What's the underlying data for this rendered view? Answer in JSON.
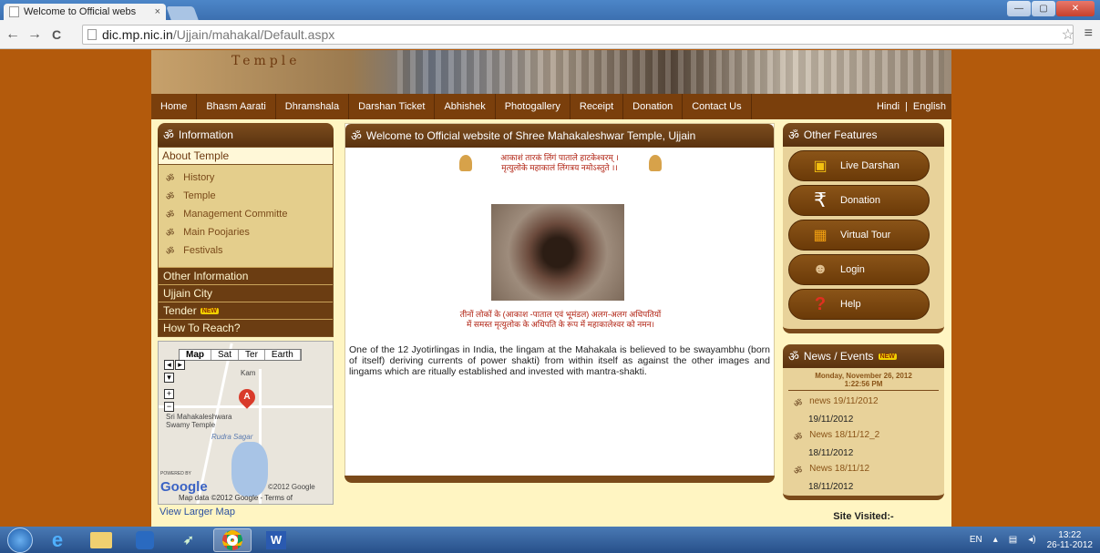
{
  "browser": {
    "tab_title": "Welcome to Official webs",
    "tab_close": "×",
    "url_host": "dic.mp.nic.in",
    "url_path": "/Ujjain/mahakal/Default.aspx",
    "back": "←",
    "forward": "→",
    "reload": "C",
    "bookmark_star": "☆",
    "menu": "≡",
    "minimize": "—",
    "maximize": "▢",
    "close": "✕"
  },
  "banner": {
    "text": "Temple"
  },
  "nav": {
    "items": [
      "Home",
      "Bhasm Aarati",
      "Dhramshala",
      "Darshan Ticket",
      "Abhishek",
      "Photogallery",
      "Receipt",
      "Donation",
      "Contact Us"
    ],
    "hindi": "Hindi",
    "separator": "|",
    "english": "English"
  },
  "left": {
    "header": "Information",
    "om": "ॐ",
    "about_title": "About Temple",
    "sub_items": [
      "History",
      "Temple",
      "Management Committe",
      "Main Poojaries",
      "Festivals"
    ],
    "other_items": [
      "Other Information",
      "Ujjain City",
      "Tender",
      "How To Reach?"
    ],
    "new_badge": "NEW",
    "map": {
      "types": [
        "Map",
        "Sat",
        "Ter",
        "Earth"
      ],
      "pin_label": "A",
      "place": "Sri Mahakaleshwara Swamy Temple",
      "lake": "Rudra Sagar",
      "town": "Kam",
      "logo": "Google",
      "powered": "POWERED BY",
      "copyright": "©2012 Google",
      "data": "Map data ©2012 Google - Terms of"
    },
    "view_larger": "View Larger Map"
  },
  "center": {
    "header": "Welcome to Official website of Shree Mahakaleshwar Temple, Ujjain",
    "mantra_line1": "आकाशं तारकं लिंगं पाताले हाटकेश्वरम् ।",
    "mantra_line2": "मृत्युलोके महाकालं लिंगत्रय नमोऽस्तुते ।।",
    "hindi_line1": "तीनों लोकों के (आकाश -पाताल एवं भूमंडल) अलग-अलग अधिपतियों",
    "hindi_line2": "में समस्त मृत्युलोक के अधिपति के रूप में महाकालेश्वर को नमन।",
    "description": "One of the 12 Jyotirlingas in India, the lingam at the Mahakala is believed to be swayambhu (born of itself) deriving currents of power shakti) from within itself as against the other images and lingams which are ritually established and invested with mantra-shakti."
  },
  "right": {
    "features_header": "Other Features",
    "features": [
      "Live Darshan",
      "Donation",
      "Virtual Tour",
      "Login",
      "Help"
    ],
    "news_header": "News / Events",
    "news_date": "Monday, November 26, 2012",
    "news_time": "1:22:56 PM",
    "news": [
      {
        "title": "news 19/11/2012",
        "date": "19/11/2012"
      },
      {
        "title": "News 18/11/12_2",
        "date": "18/11/2012"
      },
      {
        "title": "News 18/11/12",
        "date": "18/11/2012"
      }
    ],
    "site_visited": "Site Visited:-"
  },
  "taskbar": {
    "word": "W",
    "lang": "EN",
    "time": "13:22",
    "date": "26-11-2012"
  }
}
